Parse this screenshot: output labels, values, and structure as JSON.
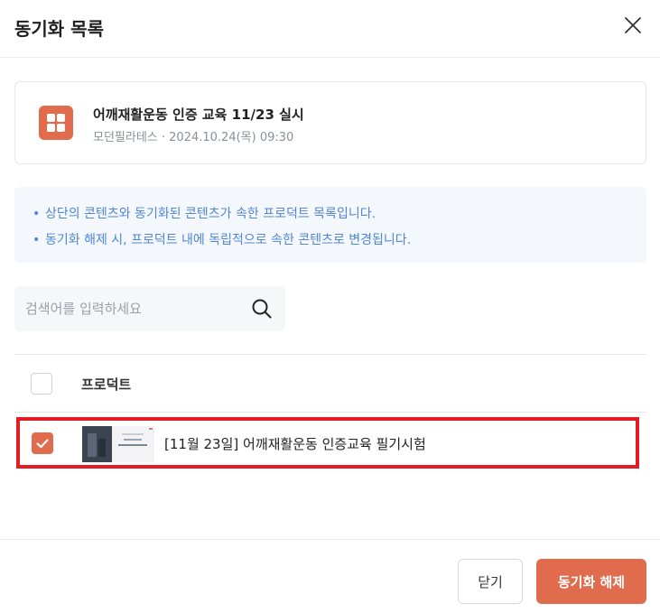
{
  "modal": {
    "title": "동기화 목록"
  },
  "content": {
    "title": "어깨재활운동 인증 교육 11/23 실시",
    "meta": "모던필라테스 · 2024.10.24(목) 09:30"
  },
  "info": {
    "lines": [
      "상단의 콘텐츠와 동기화된 콘텐츠가 속한 프로덕트 목록입니다.",
      "동기화 해제 시, 프로덕트 내에 독립적으로 속한 콘텐츠로 변경됩니다."
    ]
  },
  "search": {
    "placeholder": "검색어를 입력하세요",
    "value": ""
  },
  "table": {
    "header": "프로덕트",
    "rows": [
      {
        "label": "[11월 23일] 어깨재활운동 인증교육 필기시험",
        "checked": true
      }
    ]
  },
  "footer": {
    "close_label": "닫기",
    "unsync_label": "동기화 해제"
  },
  "colors": {
    "accent": "#e06c4d",
    "info_text": "#4f87d6",
    "highlight": "#e21d25"
  }
}
